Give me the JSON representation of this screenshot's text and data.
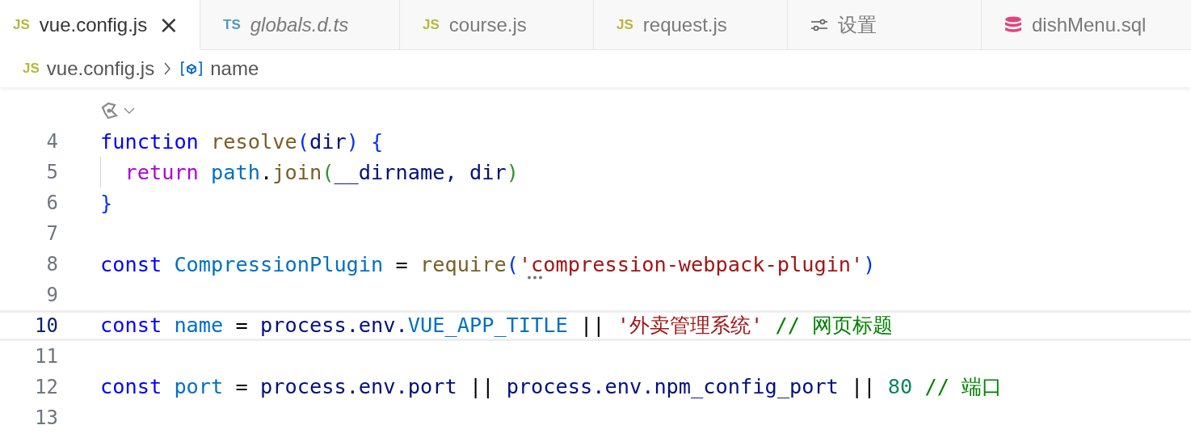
{
  "tabs": [
    {
      "kind": "js",
      "badge": "JS",
      "label": "vue.config.js",
      "italic": false,
      "selected": true,
      "close": "×"
    },
    {
      "kind": "ts",
      "badge": "TS",
      "label": "globals.d.ts",
      "italic": true,
      "selected": false
    },
    {
      "kind": "js",
      "badge": "JS",
      "label": "course.js",
      "italic": false,
      "selected": false
    },
    {
      "kind": "js",
      "badge": "JS",
      "label": "request.js",
      "italic": false,
      "selected": false
    },
    {
      "kind": "settings",
      "label": "设置",
      "italic": false,
      "selected": false
    },
    {
      "kind": "database",
      "label": "dishMenu.sql",
      "italic": false,
      "selected": false
    }
  ],
  "breadcrumb": [
    {
      "kind": "file",
      "badge": "JS",
      "label": "vue.config.js"
    },
    {
      "kind": "symbol",
      "label": "name"
    }
  ],
  "lines": [
    {
      "number": "4",
      "current": false,
      "guide": false,
      "tokens": [
        {
          "t": "function ",
          "color": "#0000ff"
        },
        {
          "t": "resolve",
          "color": "#795e26"
        },
        {
          "t": "(",
          "color": "#0431fa"
        },
        {
          "t": "dir",
          "color": "#001080"
        },
        {
          "t": ") {",
          "color": "#0431fa"
        }
      ]
    },
    {
      "number": "5",
      "current": false,
      "guide": true,
      "tokens": [
        {
          "t": "  return ",
          "color": "#af00db"
        },
        {
          "t": "path",
          "color": "#0070c1"
        },
        {
          "t": ".",
          "color": "#000000"
        },
        {
          "t": "join",
          "color": "#795e26"
        },
        {
          "t": "(",
          "color": "#319331"
        },
        {
          "t": "__dirname, dir",
          "color": "#001080"
        },
        {
          "t": ")",
          "color": "#319331"
        }
      ]
    },
    {
      "number": "6",
      "current": false,
      "guide": false,
      "tokens": [
        {
          "t": "}",
          "color": "#0431fa"
        }
      ]
    },
    {
      "number": "7",
      "current": false,
      "guide": false
    },
    {
      "number": "8",
      "current": false,
      "guide": false,
      "tokens": [
        {
          "t": "const ",
          "color": "#0000ff"
        },
        {
          "t": "CompressionPlugin",
          "color": "#0070c1"
        },
        {
          "t": " = ",
          "color": "#000000"
        },
        {
          "t": "require",
          "color": "#795e26"
        },
        {
          "t": "(",
          "color": "#0431fa"
        },
        {
          "t": "'compression-webpack-plugin'",
          "color": "#a31515",
          "hint": true
        },
        {
          "t": ")",
          "color": "#0431fa"
        }
      ]
    },
    {
      "number": "9",
      "current": false,
      "guide": false
    },
    {
      "number": "10",
      "current": true,
      "guide": false,
      "tokens": [
        {
          "t": "const ",
          "color": "#0000ff"
        },
        {
          "t": "name",
          "color": "#0070c1"
        },
        {
          "t": " = ",
          "color": "#000000"
        },
        {
          "t": "process.env.",
          "color": "#001080"
        },
        {
          "t": "VUE_APP_TITLE",
          "color": "#0070c1"
        },
        {
          "t": " || ",
          "color": "#000000"
        },
        {
          "t": "'外卖管理系统'",
          "color": "#a31515"
        },
        {
          "t": " // 网页标题",
          "color": "#008000"
        }
      ]
    },
    {
      "number": "11",
      "current": false,
      "guide": false
    },
    {
      "number": "12",
      "current": false,
      "guide": false,
      "tokens": [
        {
          "t": "const ",
          "color": "#0000ff"
        },
        {
          "t": "port",
          "color": "#0070c1"
        },
        {
          "t": " = ",
          "color": "#000000"
        },
        {
          "t": "process.env.port",
          "color": "#001080"
        },
        {
          "t": " || ",
          "color": "#000000"
        },
        {
          "t": "process.env.npm_config_port",
          "color": "#001080"
        },
        {
          "t": " || ",
          "color": "#000000"
        },
        {
          "t": "80",
          "color": "#098658"
        },
        {
          "t": " // 端口",
          "color": "#008000"
        }
      ]
    },
    {
      "number": "13",
      "current": false,
      "guide": false
    }
  ]
}
